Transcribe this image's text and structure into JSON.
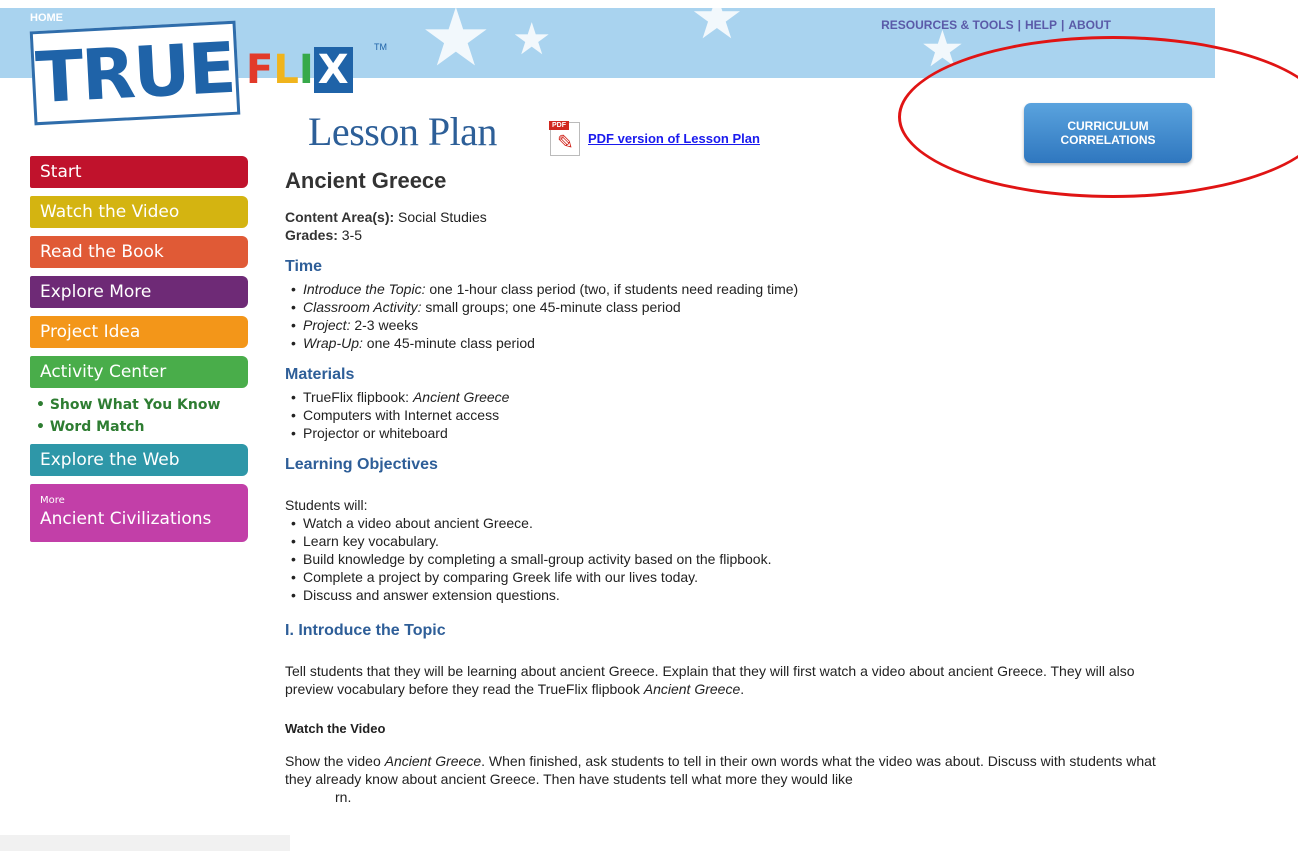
{
  "header": {
    "home": "HOME",
    "top_links": [
      "RESOURCES & TOOLS",
      "HELP",
      "ABOUT"
    ],
    "logo": {
      "true": "TRUE",
      "flix": [
        "F",
        "L",
        "I",
        "X"
      ],
      "tm": "TM"
    }
  },
  "lesson": {
    "title": "Lesson Plan",
    "pdf_icon_tag": "PDF",
    "pdf_link": "PDF version of Lesson Plan"
  },
  "curriculum_button": {
    "line1": "CURRICULUM",
    "line2": "CORRELATIONS"
  },
  "nav": {
    "start": "Start",
    "watch_video": "Watch the Video",
    "read_book": "Read the Book",
    "explore_more": "Explore More",
    "project_idea": "Project Idea",
    "activity_center": "Activity Center",
    "sub": [
      "• Show What You Know",
      "• Word Match"
    ],
    "explore_web": "Explore the Web",
    "more_small": "More",
    "more_label": "Ancient Civilizations"
  },
  "content": {
    "title": "Ancient Greece",
    "content_area_label": "Content Area(s):",
    "content_area_value": " Social Studies",
    "grades_label": "Grades:",
    "grades_value": " 3-5",
    "time_heading": "Time",
    "time_items": [
      {
        "label": "Introduce the Topic:",
        "text": " one 1-hour class period (two, if students need reading time)"
      },
      {
        "label": "Classroom Activity:",
        "text": " small groups; one 45-minute class period"
      },
      {
        "label": "Project:",
        "text": " 2-3 weeks"
      },
      {
        "label": "Wrap-Up:",
        "text": " one 45-minute class period"
      }
    ],
    "materials_heading": "Materials",
    "materials": [
      {
        "text": "TrueFlix flipbook: ",
        "italic": "Ancient Greece"
      },
      {
        "text": "Computers with Internet access",
        "italic": ""
      },
      {
        "text": "Projector or whiteboard",
        "italic": ""
      }
    ],
    "objectives_heading": "Learning Objectives",
    "students_will": "Students will:",
    "objectives": [
      "Watch a video about ancient Greece.",
      "Learn key vocabulary.",
      "Build knowledge by completing a small-group activity based on the flipbook.",
      "Complete a project by comparing Greek life with our lives today.",
      "Discuss and answer extension questions."
    ],
    "intro_heading": "I. Introduce the Topic",
    "intro_text_1": "Tell students that they will be learning about ancient Greece. Explain that they will first watch a video about ancient Greece. They will also preview vocabulary before they read the TrueFlix flipbook ",
    "intro_text_italic": "Ancient Greece",
    "intro_text_end": ".",
    "watch_heading": "Watch the Video",
    "watch_text_1": "Show the video ",
    "watch_text_italic": "Ancient Greece",
    "watch_text_2": ". When finished, ask students to tell in their own words what the video was about. Discuss with students what they already know about ancient Greece. Then have students tell what more they would like",
    "watch_text_3": "rn."
  }
}
